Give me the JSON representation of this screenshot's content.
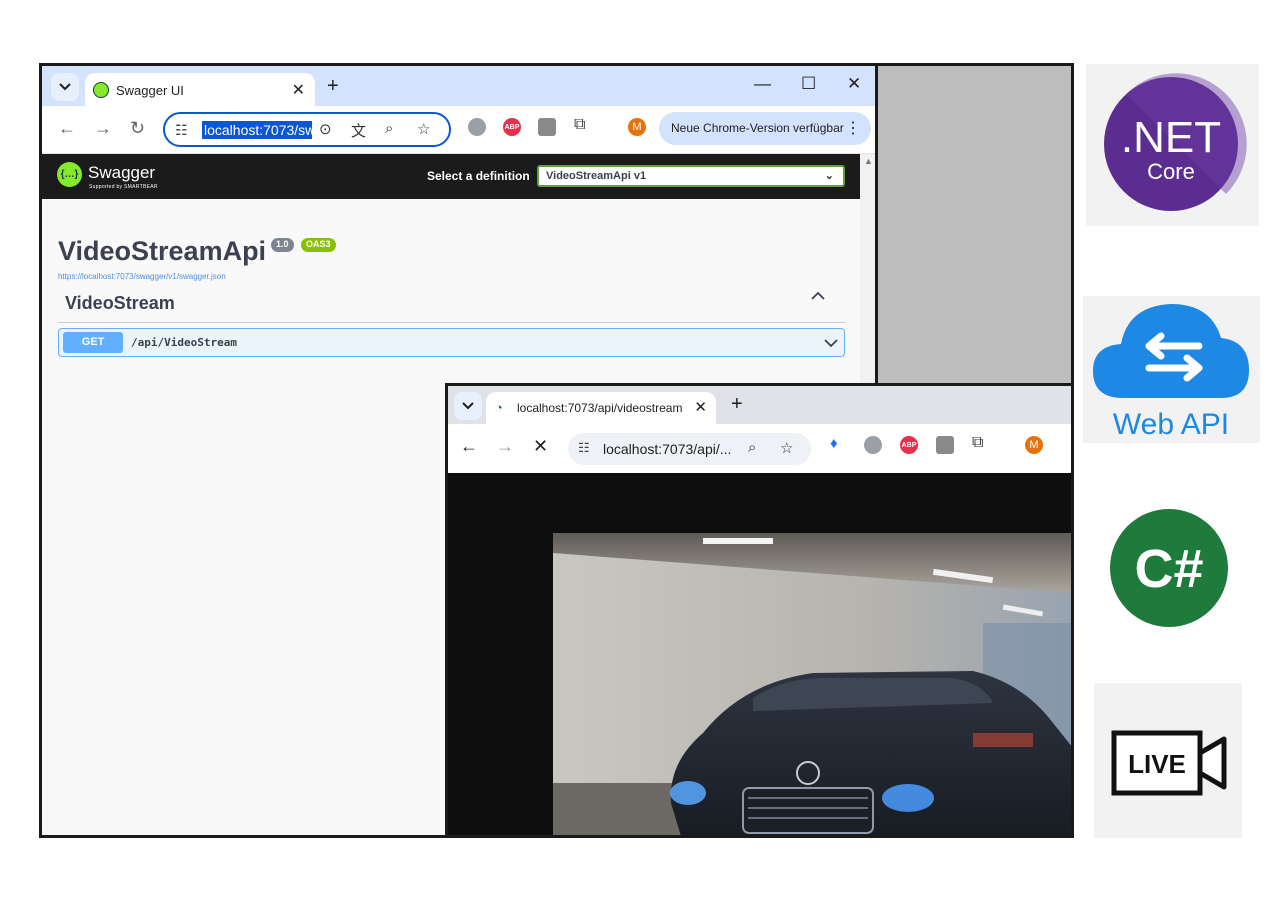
{
  "window1": {
    "tab_title": "Swagger UI",
    "close_glyph": "✕",
    "newtab_glyph": "+",
    "omnibox_url": "localhost:7073/sw",
    "profile_initial": "M",
    "update_text": "Neue Chrome-Version verfügbar",
    "controls": {
      "minimize": "—",
      "maximize": "☐",
      "close": "✕"
    }
  },
  "swagger": {
    "brand": "Swagger",
    "brand_sub": "Supported by SMARTBEAR",
    "select_label": "Select a definition",
    "selected_definition": "VideoStreamApi v1",
    "api_title": "VideoStreamApi",
    "version_badge": "1.0",
    "oas_badge": "OAS3",
    "spec_url": "https://localhost:7073/swagger/v1/swagger.json",
    "tag": "VideoStream",
    "operation": {
      "method": "GET",
      "path": "/api/VideoStream"
    },
    "colors": {
      "get": "#61affe",
      "oas": "#89bf04",
      "version": "#7d8492",
      "topbar": "#1b1b1b"
    }
  },
  "window2": {
    "tab_title": "localhost:7073/api/videostream",
    "omnibox_url": "localhost:7073/api/...",
    "profile_initial": "M"
  },
  "logos": {
    "netcore": {
      "line1": ".NET",
      "line2": "Core",
      "color": "#5c2d91"
    },
    "webapi": {
      "label": "Web API",
      "color": "#1e88e5"
    },
    "csharp": {
      "label": "C#",
      "color": "#1e7b3b"
    },
    "live": {
      "label": "LIVE"
    }
  },
  "icons": [
    "chevron-down-icon",
    "swagger-favicon-icon",
    "close-icon",
    "plus-icon",
    "back-arrow-icon",
    "forward-arrow-icon",
    "reload-icon",
    "stop-icon",
    "tune-icon",
    "lens-icon",
    "translate-icon",
    "zoom-icon",
    "star-icon",
    "shield-extension-icon",
    "abp-icon",
    "puzzle-icon",
    "more-vert-icon",
    "video-camera-icon"
  ]
}
